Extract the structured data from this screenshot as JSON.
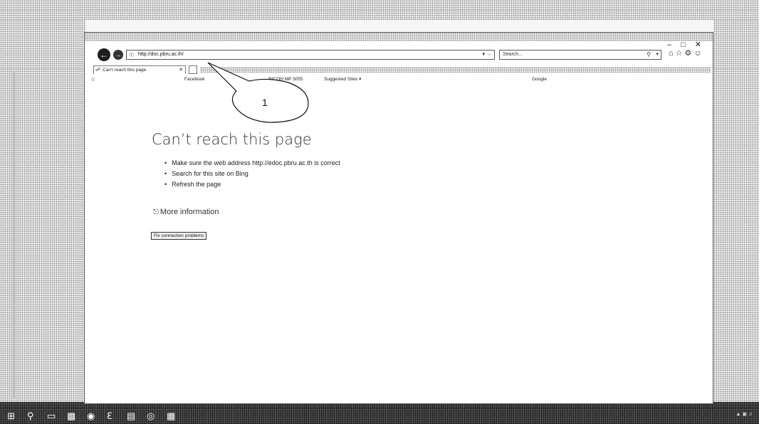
{
  "browser": {
    "address": "http://doc.pbru.ac.th/",
    "search_placeholder": "Search...",
    "tab_title": "Can't reach this page",
    "favorites": [
      "Facebook",
      "RICOH MP 5055",
      "Suggested Sites ▾",
      "Google"
    ],
    "window_controls": [
      "–",
      "□",
      "✕"
    ]
  },
  "error_page": {
    "title": "Can’t reach this page",
    "suggestions": [
      "Make sure the web address http://edoc.pbru.ac.th is correct",
      "Search for this site on Bing",
      "Refresh the page"
    ],
    "more_info": "More information",
    "fix_button": "Fix connection problems"
  },
  "callout": {
    "label": "1"
  },
  "icons": {
    "back": "back-arrow-icon",
    "forward": "forward-arrow-icon",
    "search": "search-icon",
    "home": "home-icon",
    "favorites": "star-icon",
    "tools": "gear-icon",
    "more_info": "chevron-circle-icon"
  },
  "colors": {
    "nav_button": "#1d1d1d",
    "page_bg": "#ffffff"
  }
}
